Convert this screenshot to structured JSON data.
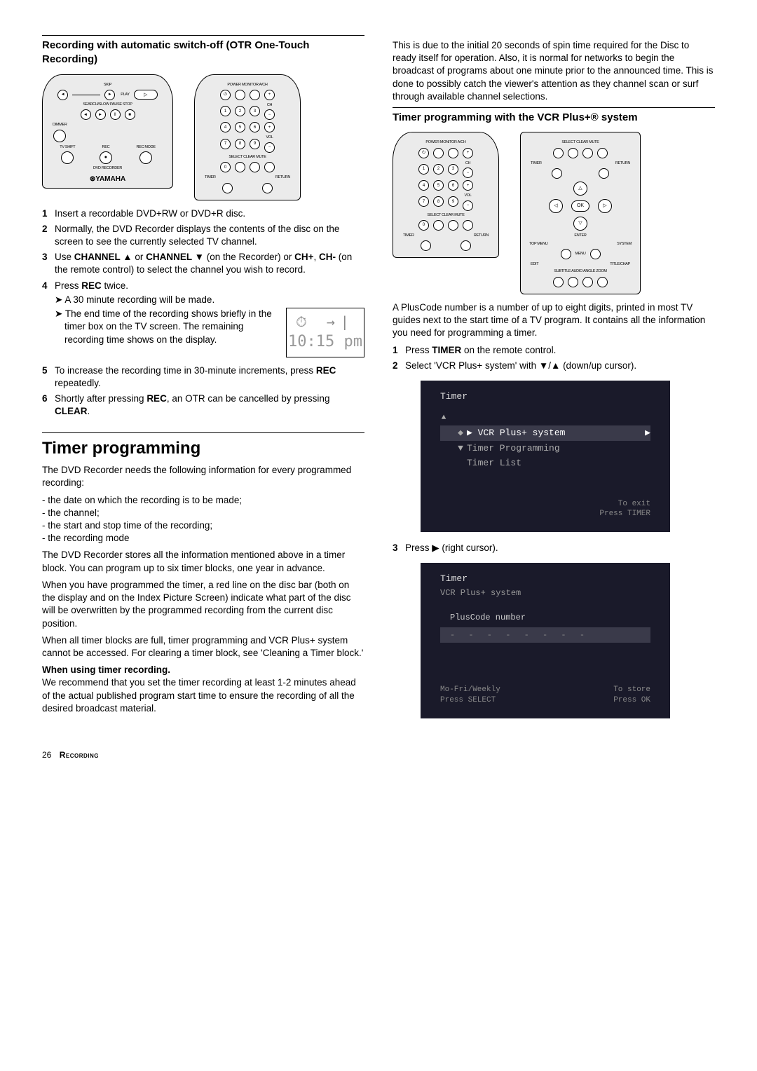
{
  "page_number": "26",
  "footer_section": "Recording",
  "left": {
    "h1": "Recording with automatic switch-off (OTR One-Touch Recording)",
    "remote1": {
      "top_labels": [
        "SKIP"
      ],
      "row1_sides": [
        "◄◄",
        "►►"
      ],
      "play_label": "PLAY",
      "row2_labels": "SEARCH/SLOW     PAUSE   STOP",
      "row2_btns": [
        "◄",
        "►",
        "II",
        "■"
      ],
      "dimmer": "DIMMER",
      "tvshift": "TV SHIFT",
      "rec": "REC",
      "recmode": "REC MODE",
      "dvd_rec": "DVD RECORDER",
      "brand": "YAMAHA"
    },
    "remote2": {
      "top_labels": "POWER  MONITOR   A/CH",
      "ch_plus": "+",
      "ch_label": "CH",
      "ch_minus": "−",
      "vol_plus": "+",
      "vol_label": "VOL",
      "vol_minus": "−",
      "nums": [
        "1",
        "2",
        "3",
        "4",
        "5",
        "6",
        "7",
        "8",
        "9",
        "0"
      ],
      "row_labels": "SELECT  CLEAR   MUTE",
      "timer": "TIMER",
      "return": "RETURN"
    },
    "clock_time": "10:15 pm",
    "steps": [
      {
        "n": "1",
        "t": "Insert a recordable DVD+RW or DVD+R disc."
      },
      {
        "n": "2",
        "t": "Normally, the DVD Recorder displays the contents of the disc on the screen to see the currently selected TV channel."
      },
      {
        "n": "3",
        "pre": "Use ",
        "b1": "CHANNEL ▲",
        "mid1": " or ",
        "b2": "CHANNEL ▼",
        "mid2": " (on the Recorder) or ",
        "b3": "CH+",
        "mid3": ", ",
        "b4": "CH-",
        "tail": " (on the remote control) to select the channel you wish to record."
      },
      {
        "n": "4",
        "pre": "Press ",
        "b1": "REC",
        "tail": " twice.",
        "sub1": "A 30 minute recording will be made.",
        "sub2": "The end time of the recording shows briefly in the timer box on the TV screen. The remaining recording time shows on the display."
      },
      {
        "n": "5",
        "pre": "To increase the recording time in 30-minute increments, press ",
        "b1": "REC",
        "tail": " repeatedly."
      },
      {
        "n": "6",
        "pre": "Shortly after pressing ",
        "b1": "REC",
        "mid1": ", an OTR can be cancelled by pressing ",
        "b2": "CLEAR",
        "tail": "."
      }
    ],
    "h2": "Timer programming",
    "p1": "The DVD Recorder needs the following information for every programmed recording:",
    "bullets": [
      "the date on which the recording is to be made;",
      "the channel;",
      "the start and stop time of the recording;",
      "the recording mode"
    ],
    "p2": "The DVD Recorder stores all the information mentioned above in a timer block. You can program up to six timer blocks, one year in advance.",
    "p3": "When you have programmed the timer, a red line on the disc bar (both on the display and on the Index Picture Screen) indicate what part of the disc will be overwritten by the programmed recording from the current disc position.",
    "p4": "When all timer blocks are full, timer programming and VCR Plus+ system cannot be accessed. For clearing a timer block, see 'Cleaning a Timer block.'",
    "p5_b": "When using timer recording.",
    "p5": "We recommend that you set the timer recording at least 1-2 minutes ahead of the actual published program start time to ensure the recording of all the desired broadcast material."
  },
  "right": {
    "p0": "This is due to the initial 20 seconds of spin time required for the Disc to ready itself for operation. Also, it is normal for networks to begin the broadcast of programs about one minute prior to the announced time. This is done to possibly catch the viewer's attention as they channel scan or surf through available channel selections.",
    "h1": "Timer programming with the VCR Plus+® system",
    "remote_nav": {
      "top_labels": "SELECT  CLEAR   MUTE",
      "timer": "TIMER",
      "return": "RETURN",
      "ok": "OK",
      "enter": "ENTER",
      "topmenu": "TOP MENU",
      "system": "SYSTEM",
      "edit": "EDIT",
      "menu": "MENU",
      "title": "TITLE/CHAP",
      "bottom_labels": "SUBTITLE  AUDIO   ANGLE  ZOOM"
    },
    "p1": "A PlusCode number is a number of up to eight digits, printed in most TV guides next to the start time of a TV program. It contains all the information you need for programming a timer.",
    "steps_a": [
      {
        "n": "1",
        "pre": "Press ",
        "b1": "TIMER",
        "tail": " on the remote control."
      },
      {
        "n": "2",
        "t": "Select 'VCR Plus+ system' with ▼/▲ (down/up cursor)."
      }
    ],
    "osd1": {
      "title": "Timer",
      "items": [
        {
          "label": "VCR Plus+ system",
          "sel": true
        },
        {
          "label": "Timer Programming",
          "sel": false
        },
        {
          "label": "Timer List",
          "sel": false
        }
      ],
      "hint1": "To exit",
      "hint2": "Press TIMER"
    },
    "step3": {
      "n": "3",
      "t": "Press ▶ (right cursor)."
    },
    "osd2": {
      "title": "Timer",
      "subtitle": "VCR Plus+ system",
      "label": "PlusCode number",
      "dashes": "- - - - - - - -",
      "foot_l1": "Mo-Fri/Weekly",
      "foot_l2": "Press SELECT",
      "foot_r1": "To store",
      "foot_r2": "Press OK"
    }
  }
}
